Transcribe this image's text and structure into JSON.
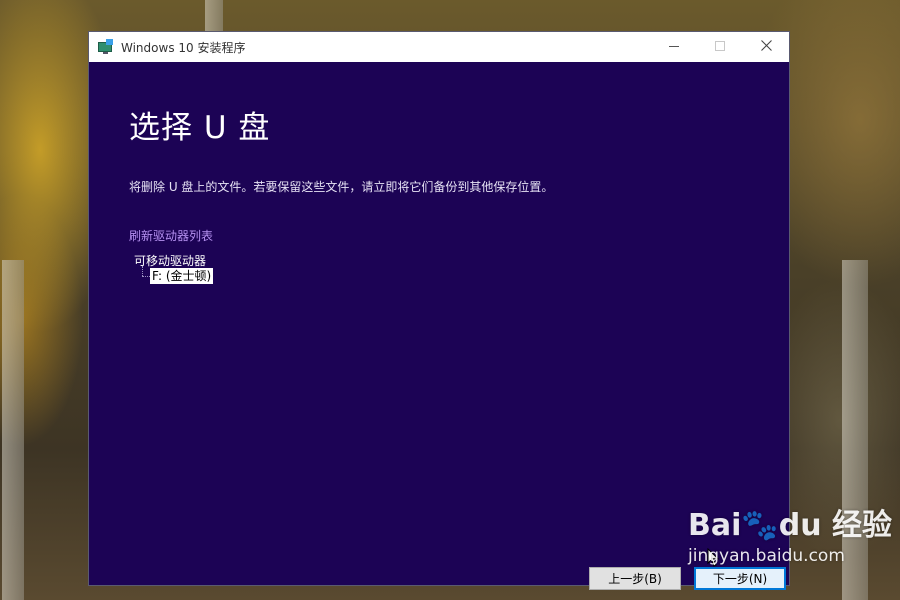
{
  "window": {
    "title": "Windows 10 安装程序",
    "controls": {
      "minimize_icon": "minimize-icon",
      "maximize_icon": "maximize-icon",
      "close_icon": "close-icon"
    }
  },
  "page": {
    "heading": "选择 U 盘",
    "subtitle": "将删除 U 盘上的文件。若要保留这些文件，请立即将它们备份到其他保存位置。",
    "refresh_link": "刷新驱动器列表"
  },
  "drive_tree": {
    "root_label": "可移动驱动器",
    "items": [
      {
        "label": "F: (金士顿)",
        "selected": true
      }
    ]
  },
  "footer": {
    "back_label": "上一步(B)",
    "next_label": "下一步(N)"
  },
  "watermark": {
    "logo_text": "Bai🐾du 经验",
    "url": "jingyan.baidu.com"
  },
  "colors": {
    "window_bg": "#1c0355",
    "link": "#b590f0",
    "accent": "#0078d7"
  }
}
